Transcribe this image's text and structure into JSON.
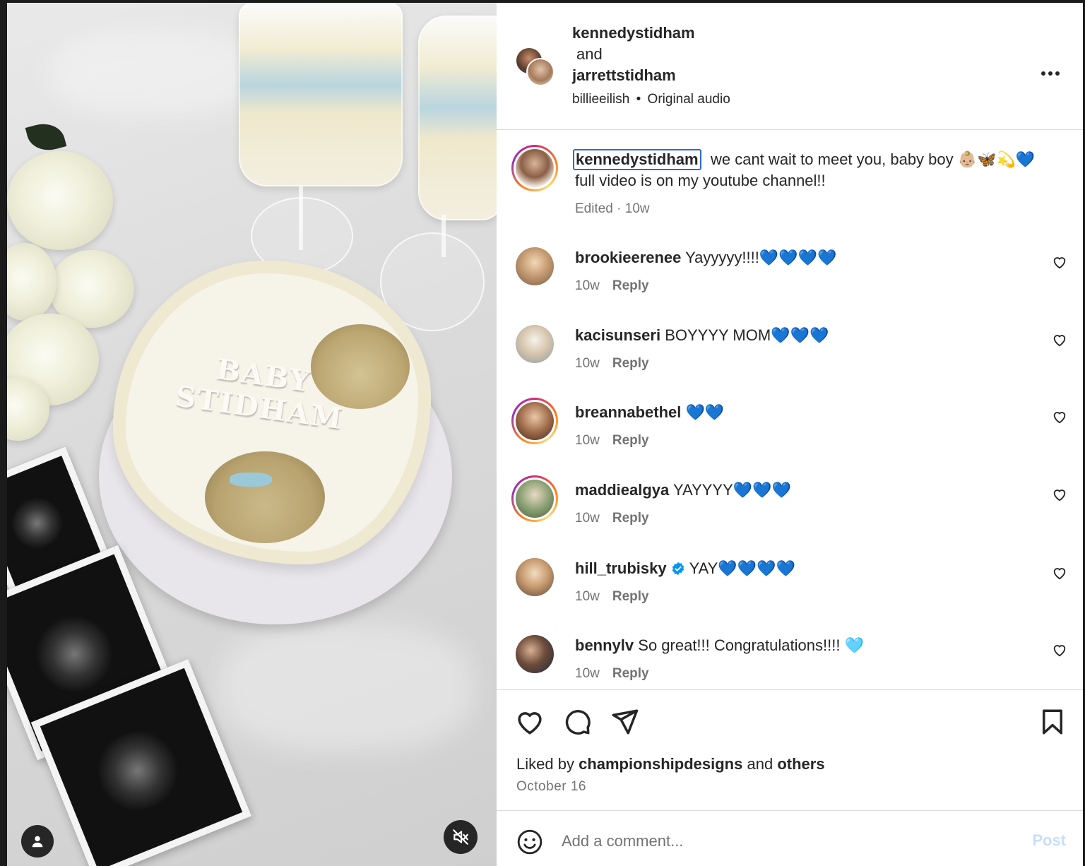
{
  "header": {
    "user1": "kennedystidham",
    "and_text": "and",
    "user2": "jarrettstidham",
    "audio_artist": "billieeilish",
    "separator": "•",
    "audio_label": "Original audio",
    "more_icon": "more-options-icon"
  },
  "media": {
    "cake_text": "BABY STIDHAM",
    "profile_icon": "person-icon",
    "mute_icon": "muted-speaker-icon"
  },
  "caption": {
    "username": "kennedystidham",
    "text": "we cant wait to meet you, baby boy 👶🏼🦋💫💙",
    "line2": "full video is on my youtube channel!!",
    "meta": "Edited · 10w"
  },
  "comments": [
    {
      "username": "brookieerenee",
      "text": "Yayyyyy!!!!💙💙💙💙",
      "time": "10w",
      "reply": "Reply",
      "verified": false,
      "ring": false
    },
    {
      "username": "kacisunseri",
      "text": "BOYYYY MOM💙💙💙",
      "time": "10w",
      "reply": "Reply",
      "verified": false,
      "ring": false
    },
    {
      "username": "breannabethel",
      "text": "💙💙",
      "time": "10w",
      "reply": "Reply",
      "verified": false,
      "ring": true
    },
    {
      "username": "maddiealgya",
      "text": "YAYYYY💙💙💙",
      "time": "10w",
      "reply": "Reply",
      "verified": false,
      "ring": true
    },
    {
      "username": "hill_trubisky",
      "text": "YAY💙💙💙💙",
      "time": "10w",
      "reply": "Reply",
      "verified": true,
      "ring": false
    },
    {
      "username": "bennylv",
      "text": "So great!!! Congratulations!!!! 🩵",
      "time": "10w",
      "reply": "Reply",
      "verified": false,
      "ring": false
    }
  ],
  "actions": {
    "like_icon": "heart-icon",
    "comment_icon": "comment-icon",
    "share_icon": "send-icon",
    "save_icon": "bookmark-icon",
    "liked_prefix": "Liked by",
    "liked_user": "championshipdesigns",
    "liked_and": "and",
    "liked_others": "others",
    "date": "October 16"
  },
  "add_comment": {
    "emoji_icon": "emoji-icon",
    "placeholder": "Add a comment...",
    "post_label": "Post"
  },
  "colors": {
    "accent": "#0095f6",
    "post_disabled": "#c6dffb",
    "muted_text": "#737373",
    "focus_outline": "#2c6ad3"
  }
}
